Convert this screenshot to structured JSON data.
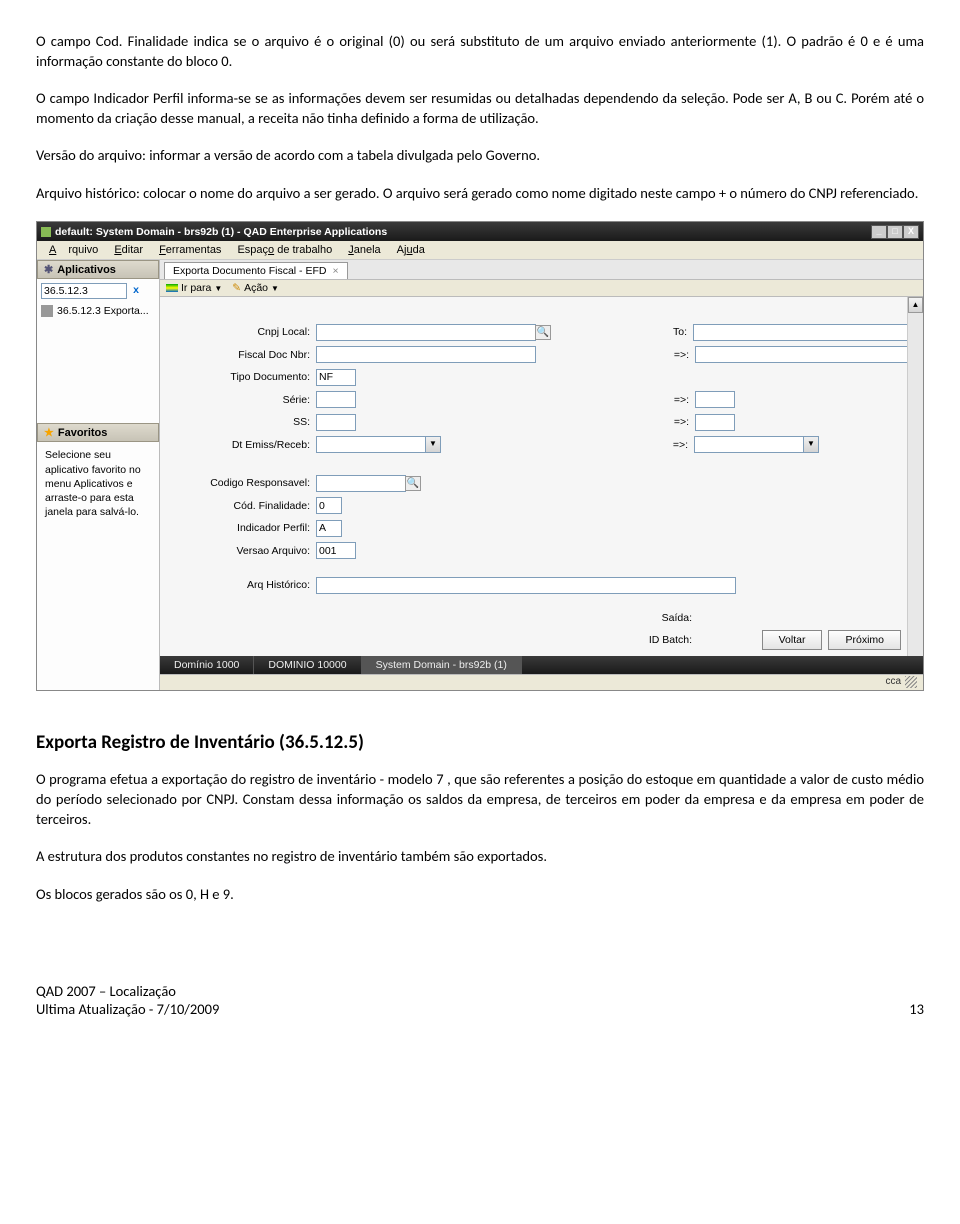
{
  "doc": {
    "p1": "O campo Cod. Finalidade indica se o arquivo é o original (0) ou será substituto de um arquivo enviado anteriormente (1).  O padrão é 0 e é uma informação constante do bloco 0.",
    "p2": "O campo Indicador Perfil informa-se se as informações devem ser resumidas ou detalhadas dependendo da seleção. Pode ser A, B ou C. Porém até o momento da criação desse manual, a receita não tinha definido a forma de utilização.",
    "p3": "Versão do arquivo: informar a versão de acordo com a tabela divulgada pelo Governo.",
    "p4": "Arquivo histórico: colocar o nome do arquivo a ser gerado. O arquivo será gerado como nome digitado neste campo + o número do CNPJ referenciado.",
    "h1": "Exporta Registro de Inventário (36.5.12.5)",
    "p5": "O programa efetua a exportação do registro de inventário - modelo 7 , que são referentes a posição do estoque em quantidade a valor de custo médio do período selecionado por CNPJ. Constam dessa informação os saldos da empresa, de terceiros em poder da empresa e da empresa em poder de terceiros.",
    "p6": "A estrutura dos produtos constantes no registro de inventário também são exportados.",
    "p7": "Os blocos gerados são os 0, H e 9.",
    "footer_left1": "QAD 2007 – Localização",
    "footer_left2": "Ultima Atualização - 7/10/2009",
    "footer_page": "13"
  },
  "app": {
    "title": "default: System Domain - brs92b (1) - QAD Enterprise Applications",
    "menus": {
      "arquivo": "Arquivo",
      "editar": "Editar",
      "ferramentas": "Ferramentas",
      "espaco": "Espaço de trabalho",
      "janela": "Janela",
      "ajuda": "Ajuda"
    },
    "sidebar": {
      "aplicativos_head": "Aplicativos",
      "search_value": "36.5.12.3",
      "item_label": "36.5.12.3  Exporta...",
      "favoritos_head": "Favoritos",
      "fav_text": "Selecione seu aplicativo favorito no menu Aplicativos e arraste-o para esta janela para salvá-lo."
    },
    "tab": "Exporta Documento Fiscal - EFD",
    "toolbar": {
      "irpara": "Ir para",
      "acao": "Ação"
    },
    "form": {
      "cnpj_local": "Cnpj Local:",
      "to": "To:",
      "fiscal_doc_nbr": "Fiscal Doc Nbr:",
      "eq": "=>:",
      "tipo_documento": "Tipo Documento:",
      "tipo_documento_val": "NF",
      "serie": "Série:",
      "ss": "SS:",
      "dt_emiss": "Dt Emiss/Receb:",
      "codigo_resp": "Codigo Responsavel:",
      "cod_final": "Cód. Finalidade:",
      "cod_final_val": "0",
      "indic_perfil": "Indicador Perfil:",
      "indic_perfil_val": "A",
      "versao_arq": "Versao Arquivo:",
      "versao_arq_val": "001",
      "arq_hist": "Arq Histórico:",
      "saida": "Saída:",
      "id_batch": "ID Batch:"
    },
    "buttons": {
      "voltar": "Voltar",
      "proximo": "Próximo"
    },
    "status": {
      "d1": "Domínio 1000",
      "d2": "DOMINIO 10000",
      "d3": "System Domain - brs92b (1)",
      "user": "cca"
    }
  }
}
